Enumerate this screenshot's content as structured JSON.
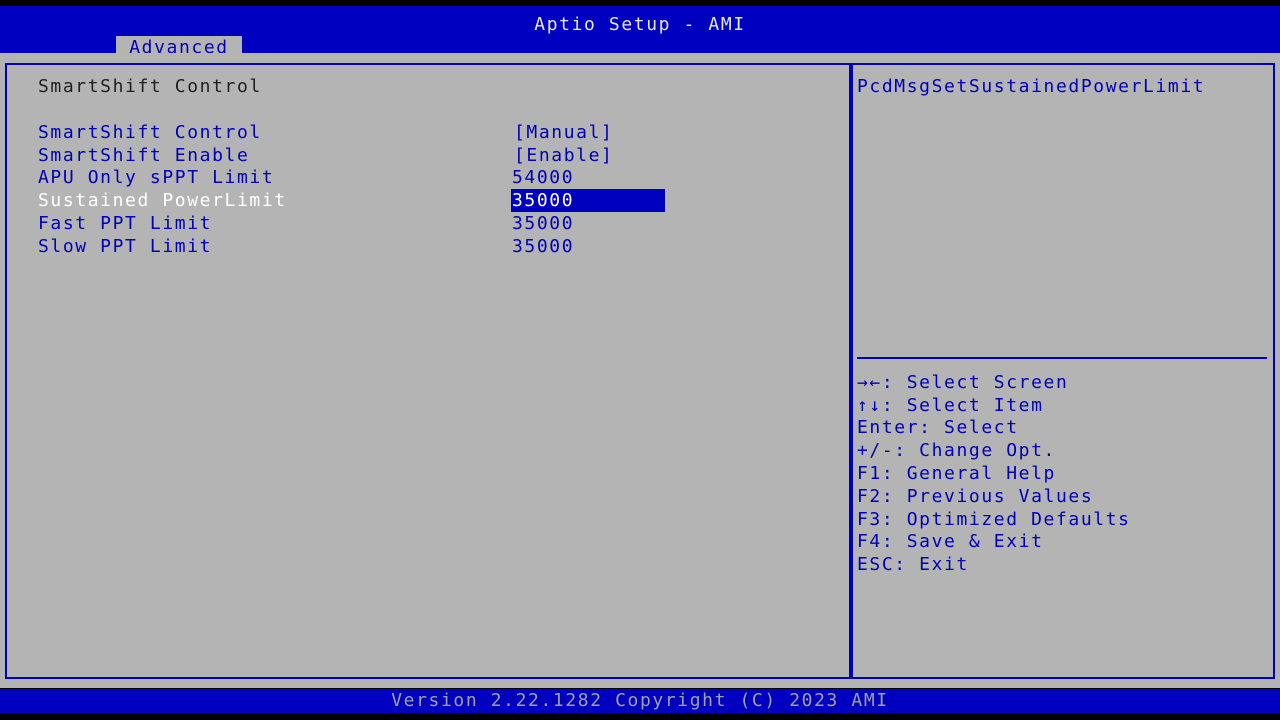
{
  "header": {
    "title": "Aptio Setup - AMI",
    "active_tab": "Advanced"
  },
  "page": {
    "section_title": "SmartShift Control"
  },
  "settings": [
    {
      "label": "SmartShift Control",
      "value": "[Manual]",
      "selected": false
    },
    {
      "label": "SmartShift Enable",
      "value": "[Enable]",
      "selected": false
    },
    {
      "label": "APU Only sPPT Limit",
      "value": "54000",
      "selected": false
    },
    {
      "label": "Sustained PowerLimit",
      "value": "35000",
      "selected": true
    },
    {
      "label": "Fast PPT Limit",
      "value": "35000",
      "selected": false
    },
    {
      "label": "Slow PPT Limit",
      "value": "35000",
      "selected": false
    }
  ],
  "help": {
    "description": "PcdMsgSetSustainedPowerLimit",
    "keys": [
      "→←: Select Screen",
      "↑↓: Select Item",
      "Enter: Select",
      "+/-: Change Opt.",
      "F1: General Help",
      "F2: Previous Values",
      "F3: Optimized Defaults",
      "F4: Save & Exit",
      "ESC: Exit"
    ]
  },
  "footer": {
    "version": "Version 2.22.1282 Copyright (C) 2023 AMI"
  },
  "colors": {
    "bios_blue": "#0000c0",
    "panel_gray": "#b4b4b4",
    "label_blue": "#0000b4",
    "highlight_text": "#ffffff"
  }
}
